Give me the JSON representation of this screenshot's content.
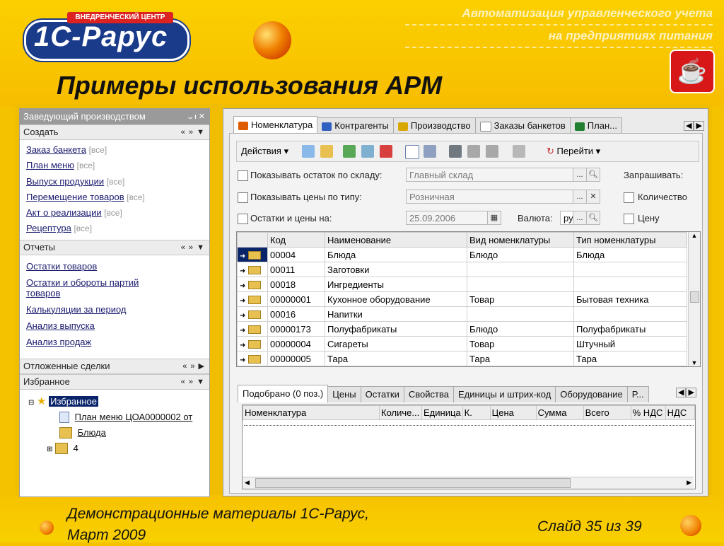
{
  "slide": {
    "tagline_line1": "Автоматизация управленческого учета",
    "tagline_line2": "на предприятиях питания",
    "title": "Примеры использования АРМ",
    "logo_text": "1С-Рарус",
    "logo_banner": "ВНЕДРЕНЧЕСКИЙ ЦЕНТР",
    "footer_line1": "Демонстрационные материалы 1С-Рарус,",
    "footer_line2": "Март 2009",
    "slide_number": "Слайд 35 из 39"
  },
  "left_panel": {
    "title": "Заведующий производством",
    "sections": {
      "create": {
        "label": "Создать",
        "items": [
          {
            "label": "Заказ банкета",
            "all": "[все]"
          },
          {
            "label": "План меню",
            "all": "[все]"
          },
          {
            "label": "Выпуск продукции",
            "all": "[все]"
          },
          {
            "label": "Перемещение товаров",
            "all": "[все]"
          },
          {
            "label": "Акт о реализации",
            "all": "[все]"
          },
          {
            "label": "Рецептура",
            "all": "[все]"
          }
        ]
      },
      "reports": {
        "label": "Отчеты",
        "items": [
          "Остатки товаров",
          "Остатки и обороты партий товаров",
          "Калькуляции за период",
          "Анализ выпуска",
          "Анализ продаж"
        ]
      },
      "deferred": {
        "label": "Отложенные сделки"
      },
      "favorites": {
        "label": "Избранное",
        "tree": [
          {
            "label": "Избранное"
          },
          {
            "label": "План меню ЦОА0000002 от"
          },
          {
            "label": "Блюда"
          },
          {
            "label": "4"
          }
        ]
      }
    }
  },
  "main": {
    "tabs": [
      "Номенклатура",
      "Контрагенты",
      "Производство",
      "Заказы банкетов",
      "План..."
    ],
    "toolbar": {
      "actions_label": "Действия",
      "goto_label": "Перейти"
    },
    "form": {
      "show_stock_label": "Показывать остаток по складу:",
      "warehouse_value": "Главный склад",
      "show_prices_label": "Показывать цены по типу:",
      "price_type_value": "Розничная",
      "stock_date_label": "Остатки и цены на:",
      "date_value": "25.09.2006",
      "currency_label": "Валюта:",
      "currency_value": "ру",
      "ask_label": "Запрашивать:",
      "qty_label": "Количество",
      "price_label": "Цену"
    },
    "grid": {
      "columns": [
        "Код",
        "Наименование",
        "Вид номенклатуры",
        "Тип номенклатуры"
      ],
      "rows": [
        {
          "code": "00004",
          "name": "Блюда",
          "kind": "Блюдо",
          "type": "Блюда"
        },
        {
          "code": "00011",
          "name": "Заготовки",
          "kind": "",
          "type": ""
        },
        {
          "code": "00018",
          "name": "Ингредиенты",
          "kind": "",
          "type": ""
        },
        {
          "code": "00000001",
          "name": "Кухонное оборудование",
          "kind": "Товар",
          "type": "Бытовая техника"
        },
        {
          "code": "00016",
          "name": "Напитки",
          "kind": "",
          "type": ""
        },
        {
          "code": "00000173",
          "name": "Полуфабрикаты",
          "kind": "Блюдо",
          "type": "Полуфабрикаты"
        },
        {
          "code": "00000004",
          "name": "Сигареты",
          "kind": "Товар",
          "type": "Штучный"
        },
        {
          "code": "00000005",
          "name": "Тара",
          "kind": "Тара",
          "type": "Тара"
        }
      ]
    },
    "bottom_tabs": [
      "Подобрано (0 поз.)",
      "Цены",
      "Остатки",
      "Свойства",
      "Единицы и штрих-код",
      "Оборудование",
      "Р..."
    ],
    "bottom_columns": [
      "Номенклатура",
      "Количе...",
      "Единица",
      "К.",
      "Цена",
      "Сумма",
      "Всего",
      "% НДС",
      "НДС"
    ]
  }
}
